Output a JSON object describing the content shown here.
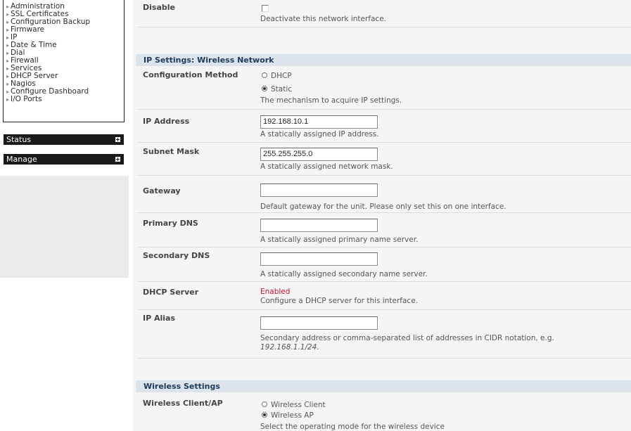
{
  "sidebar": {
    "items": [
      {
        "label": "Administration"
      },
      {
        "label": "SSL Certificates"
      },
      {
        "label": "Configuration Backup"
      },
      {
        "label": "Firmware"
      },
      {
        "label": "IP"
      },
      {
        "label": "Date & Time"
      },
      {
        "label": "Dial"
      },
      {
        "label": "Firewall"
      },
      {
        "label": "Services"
      },
      {
        "label": "DHCP Server"
      },
      {
        "label": "Nagios"
      },
      {
        "label": "Configure Dashboard"
      },
      {
        "label": "I/O Ports"
      }
    ],
    "status_label": "Status",
    "manage_label": "Manage"
  },
  "disable": {
    "label": "Disable",
    "help": "Deactivate this network interface."
  },
  "ip_settings": {
    "title": "IP Settings: Wireless Network",
    "config_method": {
      "label": "Configuration Method",
      "options": [
        "DHCP",
        "Static"
      ],
      "selected": "Static",
      "help": "The mechanism to acquire IP settings."
    },
    "ip_address": {
      "label": "IP Address",
      "value": "192.168.10.1",
      "help": "A statically assigned IP address."
    },
    "subnet_mask": {
      "label": "Subnet Mask",
      "value": "255.255.255.0",
      "help": "A statically assigned network mask."
    },
    "gateway": {
      "label": "Gateway",
      "value": "",
      "help": "Default gateway for the unit. Please only set this on one interface."
    },
    "primary_dns": {
      "label": "Primary DNS",
      "value": "",
      "help": "A statically assigned primary name server."
    },
    "secondary_dns": {
      "label": "Secondary DNS",
      "value": "",
      "help": "A statically assigned secondary name server."
    },
    "dhcp_server": {
      "label": "DHCP Server",
      "status": "Enabled",
      "help": "Configure a DHCP server for this interface."
    },
    "ip_alias": {
      "label": "IP Alias",
      "value": "",
      "help": "Secondary address or comma-separated list of addresses in CIDR notation, e.g.",
      "help_example": "192.168.1.1/24."
    }
  },
  "wireless": {
    "title": "Wireless Settings",
    "mode": {
      "label": "Wireless Client/AP",
      "options": [
        "Wireless Client",
        "Wireless AP"
      ],
      "selected": "Wireless AP",
      "help": "Select the operating mode for the wireless device"
    }
  },
  "colors": {
    "section_header_bg": "#dde3ea",
    "section_header_text": "#1d3a5c",
    "enabled_red": "#c8102e",
    "sidebar_bar": "#1a1a1a"
  }
}
